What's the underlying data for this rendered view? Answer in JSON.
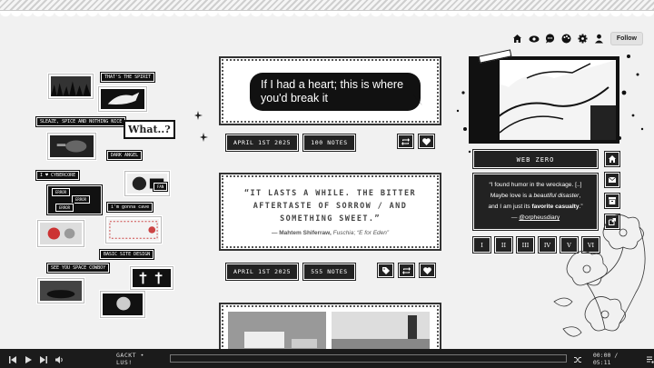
{
  "nav": {
    "icons": [
      "home-icon",
      "eye-icon",
      "chat-icon",
      "palette-icon",
      "gear-icon",
      "user-icon"
    ],
    "follow_label": "Follow"
  },
  "collage": {
    "tags": [
      "THAT'S THE SPIRIT",
      "SLEAZE, SPICE AND NOTHING NICE",
      "DARK ANGEL",
      "I ♥ CYBERCORE",
      "i'm gonna cave",
      "BASIC SITE DESIGN",
      "SEE YOU SPACE COWBOY"
    ],
    "what_text": "What..?",
    "error_text": "ERROR",
    "fan_text": "FAN"
  },
  "posts": [
    {
      "text": "If I had a heart; this is where you'd break it",
      "date": "APRIL 1ST 2025",
      "notes": "100 NOTES"
    },
    {
      "quote": "“IT LASTS A WHILE. THE BITTER AFTERTASTE OF SORROW / AND SOMETHING SWEET.”",
      "source_author": "— Mahtem Shiferraw,",
      "source_work": "Fuschia",
      "source_piece": "“E for Eden”",
      "date": "APRIL 1ST 2025",
      "notes": "555 NOTES"
    }
  ],
  "sidebar": {
    "title": "WEB ZERO",
    "quote_line1": "“I found humor in the wreckage. [..]",
    "quote_line2a": "Maybe love is a ",
    "quote_line2b": "beautiful disaster",
    "quote_line2c": ",",
    "quote_line3a": "and I am just its ",
    "quote_line3b": "favorite casualty",
    "quote_line3c": ".”",
    "quote_credit_prefix": "— ",
    "quote_credit": "@orpheusdiary",
    "numerals": [
      "I",
      "II",
      "III",
      "IV",
      "V",
      "VI"
    ]
  },
  "player": {
    "track": "GACKT • LUS!",
    "time": "00:00 / 05:11",
    "progress": 0
  }
}
